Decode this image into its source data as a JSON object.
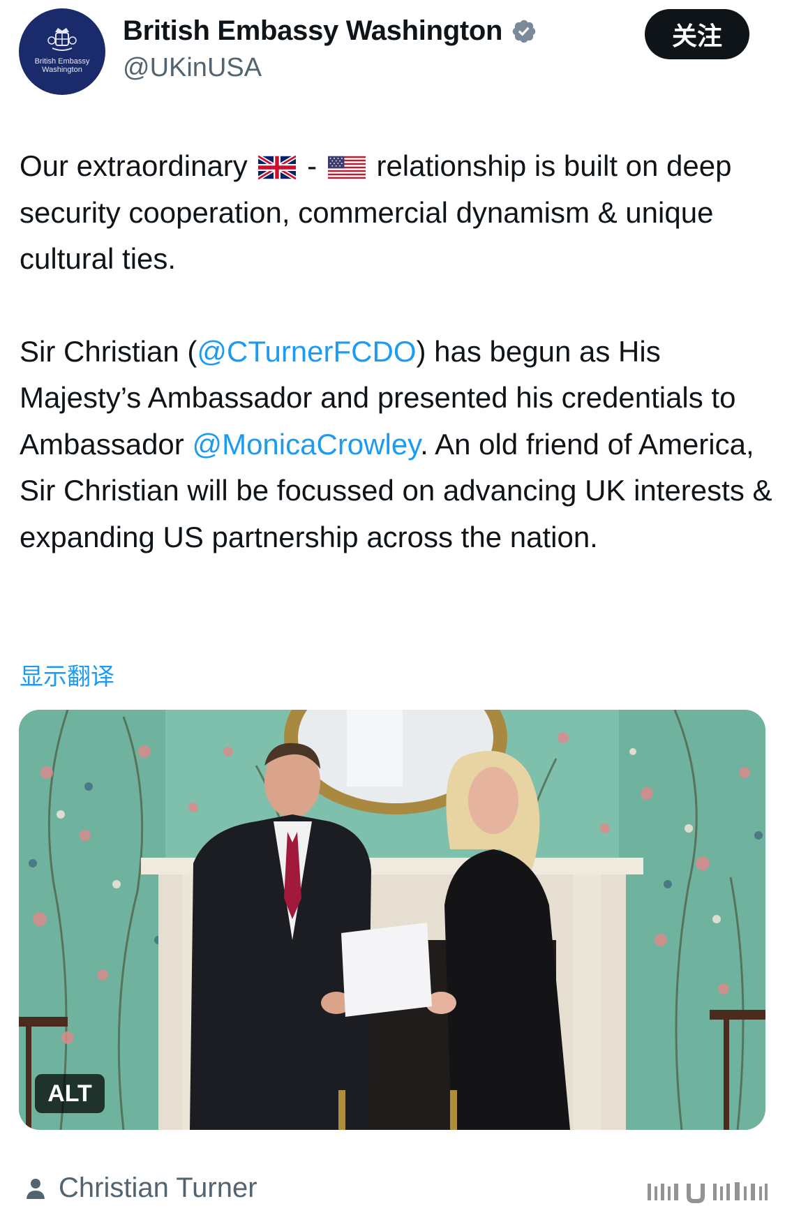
{
  "account": {
    "name": "British Embassy Washington",
    "handle": "@UKinUSA",
    "verified": true,
    "avatar_text_line1": "British Embassy",
    "avatar_text_line2": "Washington"
  },
  "follow_button": {
    "label": "关注"
  },
  "tweet": {
    "p1_before": "Our extraordinary ",
    "p1_dash": " - ",
    "p1_after": " relationship is built on deep security cooperation, commercial dynamism & unique cultural ties.",
    "p2_a": "Sir Christian (",
    "mention1": "@CTurnerFCDO",
    "p2_b": ") has begun as His Majesty’s Ambassador and presented his credentials to Ambassador ",
    "mention2": "@MonicaCrowley",
    "p2_c": ". An old friend of America, Sir Christian will be focussed on advancing UK interests & expanding US partnership across the nation."
  },
  "translate_link": "显示翻译",
  "media": {
    "alt_badge": "ALT"
  },
  "tagged": {
    "name": "Christian Turner"
  },
  "colors": {
    "text": "#0f1419",
    "secondary": "#536471",
    "link": "#1d9bf0",
    "avatar_bg": "#1b2a6b"
  },
  "icons": [
    "verified-badge-icon",
    "uk-flag-icon",
    "us-flag-icon",
    "person-icon",
    "royal-crest-icon"
  ]
}
